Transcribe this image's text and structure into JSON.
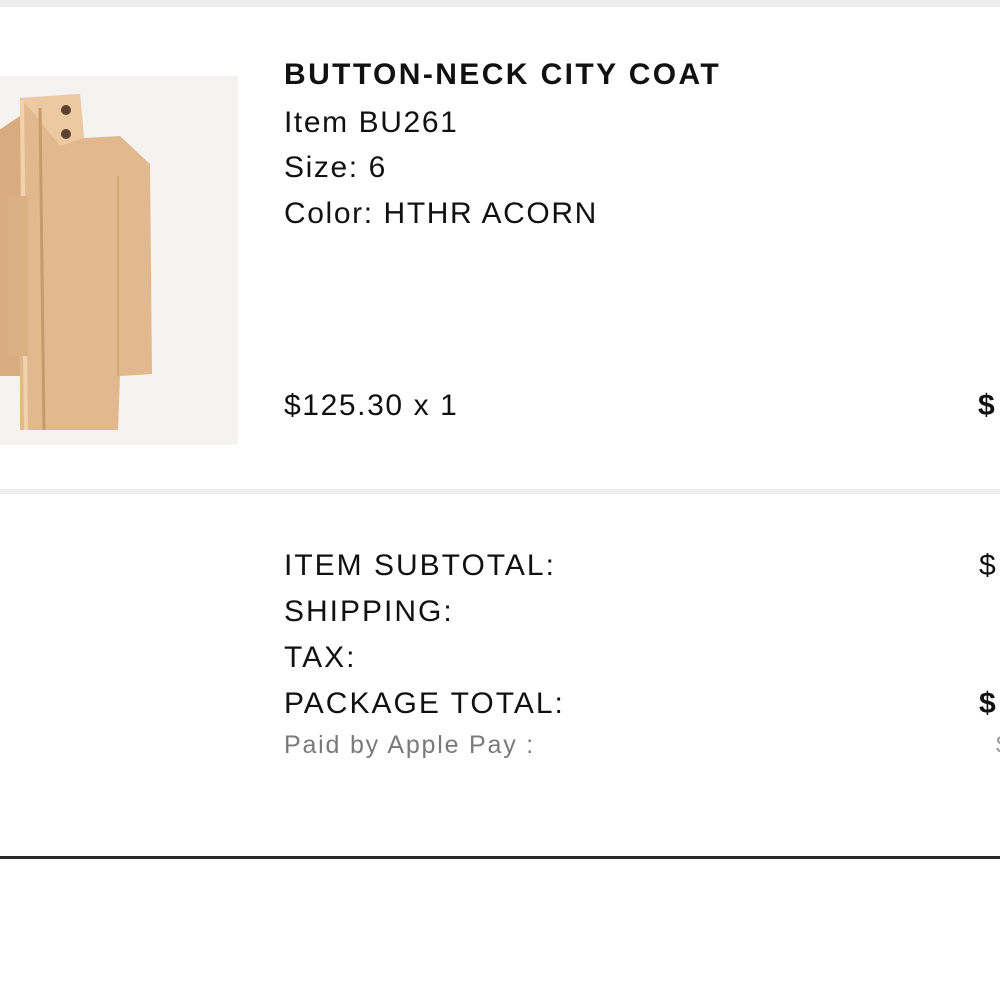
{
  "product": {
    "name": "BUTTON-NECK CITY COAT",
    "item_number": "Item BU261",
    "size": "Size: 6",
    "color": "Color: HTHR ACORN",
    "price_qty": "$125.30 x 1",
    "line_total": "$",
    "image": {
      "icon": "coat-image",
      "main_color": "#e2b98f"
    }
  },
  "summary": {
    "item_subtotal_label": "ITEM SUBTOTAL:",
    "item_subtotal_value": "$",
    "shipping_label": "SHIPPING:",
    "tax_label": "TAX:",
    "package_total_label": "PACKAGE TOTAL:",
    "package_total_value": "$",
    "paid_by_label": "Paid by Apple Pay :",
    "paid_by_value": "$"
  }
}
